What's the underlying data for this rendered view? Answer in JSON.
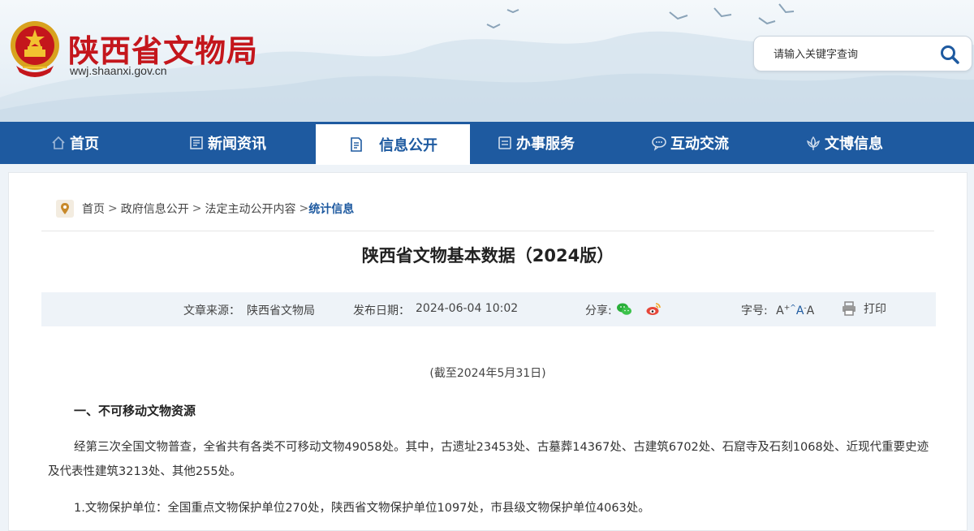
{
  "header": {
    "site_title": "陕西省文物局",
    "site_url": "wwj.shaanxi.gov.cn",
    "search_placeholder": "请输入关键字查询"
  },
  "nav": {
    "items": [
      {
        "label": "首页",
        "icon": "home-icon"
      },
      {
        "label": "新闻资讯",
        "icon": "news-icon"
      },
      {
        "label": "信息公开",
        "icon": "document-icon",
        "active": true
      },
      {
        "label": "办事服务",
        "icon": "service-icon"
      },
      {
        "label": "互动交流",
        "icon": "chat-icon"
      },
      {
        "label": "文博信息",
        "icon": "lotus-icon"
      }
    ]
  },
  "breadcrumb": {
    "items": [
      "首页",
      "政府信息公开",
      "法定主动公开内容",
      "统计信息"
    ],
    "sep": ">"
  },
  "article": {
    "title": "陕西省文物基本数据（2024版）",
    "source_label": "文章来源：",
    "source": "陕西省文物局",
    "date_label": "发布日期：",
    "date": "2024-06-04 10:02",
    "share_label": "分享:",
    "font_label": "字号:",
    "font_large": "A",
    "font_mid": "A",
    "font_small": "A",
    "print_label": "打印",
    "date_note": "(截至2024年5月31日)",
    "section1_title": "一、不可移动文物资源",
    "para1": "经第三次全国文物普查，全省共有各类不可移动文物49058处。其中，古遗址23453处、古墓葬14367处、古建筑6702处、石窟寺及石刻1068处、近现代重要史迹及代表性建筑3213处、其他255处。",
    "para2": "1.文物保护单位：全国重点文物保护单位270处，陕西省文物保护单位1097处，市县级文物保护单位4063处。"
  },
  "colors": {
    "brand_red": "#c4161c",
    "nav_blue": "#1e5aa0",
    "meta_bg": "#eef3f8"
  }
}
